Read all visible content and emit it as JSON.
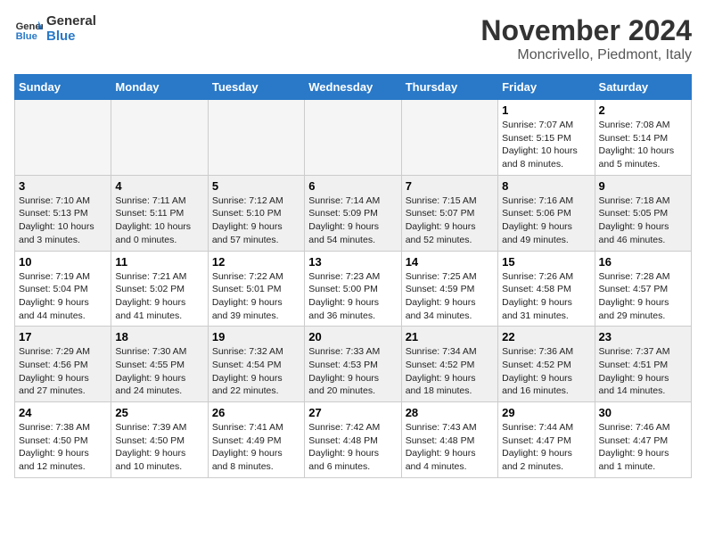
{
  "header": {
    "logo_line1": "General",
    "logo_line2": "Blue",
    "month_title": "November 2024",
    "location": "Moncrivello, Piedmont, Italy"
  },
  "weekdays": [
    "Sunday",
    "Monday",
    "Tuesday",
    "Wednesday",
    "Thursday",
    "Friday",
    "Saturday"
  ],
  "weeks": [
    [
      {
        "day": "",
        "empty": true
      },
      {
        "day": "",
        "empty": true
      },
      {
        "day": "",
        "empty": true
      },
      {
        "day": "",
        "empty": true
      },
      {
        "day": "",
        "empty": true
      },
      {
        "day": "1",
        "info": "Sunrise: 7:07 AM\nSunset: 5:15 PM\nDaylight: 10 hours\nand 8 minutes."
      },
      {
        "day": "2",
        "info": "Sunrise: 7:08 AM\nSunset: 5:14 PM\nDaylight: 10 hours\nand 5 minutes."
      }
    ],
    [
      {
        "day": "3",
        "info": "Sunrise: 7:10 AM\nSunset: 5:13 PM\nDaylight: 10 hours\nand 3 minutes."
      },
      {
        "day": "4",
        "info": "Sunrise: 7:11 AM\nSunset: 5:11 PM\nDaylight: 10 hours\nand 0 minutes."
      },
      {
        "day": "5",
        "info": "Sunrise: 7:12 AM\nSunset: 5:10 PM\nDaylight: 9 hours\nand 57 minutes."
      },
      {
        "day": "6",
        "info": "Sunrise: 7:14 AM\nSunset: 5:09 PM\nDaylight: 9 hours\nand 54 minutes."
      },
      {
        "day": "7",
        "info": "Sunrise: 7:15 AM\nSunset: 5:07 PM\nDaylight: 9 hours\nand 52 minutes."
      },
      {
        "day": "8",
        "info": "Sunrise: 7:16 AM\nSunset: 5:06 PM\nDaylight: 9 hours\nand 49 minutes."
      },
      {
        "day": "9",
        "info": "Sunrise: 7:18 AM\nSunset: 5:05 PM\nDaylight: 9 hours\nand 46 minutes."
      }
    ],
    [
      {
        "day": "10",
        "info": "Sunrise: 7:19 AM\nSunset: 5:04 PM\nDaylight: 9 hours\nand 44 minutes."
      },
      {
        "day": "11",
        "info": "Sunrise: 7:21 AM\nSunset: 5:02 PM\nDaylight: 9 hours\nand 41 minutes."
      },
      {
        "day": "12",
        "info": "Sunrise: 7:22 AM\nSunset: 5:01 PM\nDaylight: 9 hours\nand 39 minutes."
      },
      {
        "day": "13",
        "info": "Sunrise: 7:23 AM\nSunset: 5:00 PM\nDaylight: 9 hours\nand 36 minutes."
      },
      {
        "day": "14",
        "info": "Sunrise: 7:25 AM\nSunset: 4:59 PM\nDaylight: 9 hours\nand 34 minutes."
      },
      {
        "day": "15",
        "info": "Sunrise: 7:26 AM\nSunset: 4:58 PM\nDaylight: 9 hours\nand 31 minutes."
      },
      {
        "day": "16",
        "info": "Sunrise: 7:28 AM\nSunset: 4:57 PM\nDaylight: 9 hours\nand 29 minutes."
      }
    ],
    [
      {
        "day": "17",
        "info": "Sunrise: 7:29 AM\nSunset: 4:56 PM\nDaylight: 9 hours\nand 27 minutes."
      },
      {
        "day": "18",
        "info": "Sunrise: 7:30 AM\nSunset: 4:55 PM\nDaylight: 9 hours\nand 24 minutes."
      },
      {
        "day": "19",
        "info": "Sunrise: 7:32 AM\nSunset: 4:54 PM\nDaylight: 9 hours\nand 22 minutes."
      },
      {
        "day": "20",
        "info": "Sunrise: 7:33 AM\nSunset: 4:53 PM\nDaylight: 9 hours\nand 20 minutes."
      },
      {
        "day": "21",
        "info": "Sunrise: 7:34 AM\nSunset: 4:52 PM\nDaylight: 9 hours\nand 18 minutes."
      },
      {
        "day": "22",
        "info": "Sunrise: 7:36 AM\nSunset: 4:52 PM\nDaylight: 9 hours\nand 16 minutes."
      },
      {
        "day": "23",
        "info": "Sunrise: 7:37 AM\nSunset: 4:51 PM\nDaylight: 9 hours\nand 14 minutes."
      }
    ],
    [
      {
        "day": "24",
        "info": "Sunrise: 7:38 AM\nSunset: 4:50 PM\nDaylight: 9 hours\nand 12 minutes."
      },
      {
        "day": "25",
        "info": "Sunrise: 7:39 AM\nSunset: 4:50 PM\nDaylight: 9 hours\nand 10 minutes."
      },
      {
        "day": "26",
        "info": "Sunrise: 7:41 AM\nSunset: 4:49 PM\nDaylight: 9 hours\nand 8 minutes."
      },
      {
        "day": "27",
        "info": "Sunrise: 7:42 AM\nSunset: 4:48 PM\nDaylight: 9 hours\nand 6 minutes."
      },
      {
        "day": "28",
        "info": "Sunrise: 7:43 AM\nSunset: 4:48 PM\nDaylight: 9 hours\nand 4 minutes."
      },
      {
        "day": "29",
        "info": "Sunrise: 7:44 AM\nSunset: 4:47 PM\nDaylight: 9 hours\nand 2 minutes."
      },
      {
        "day": "30",
        "info": "Sunrise: 7:46 AM\nSunset: 4:47 PM\nDaylight: 9 hours\nand 1 minute."
      }
    ]
  ]
}
